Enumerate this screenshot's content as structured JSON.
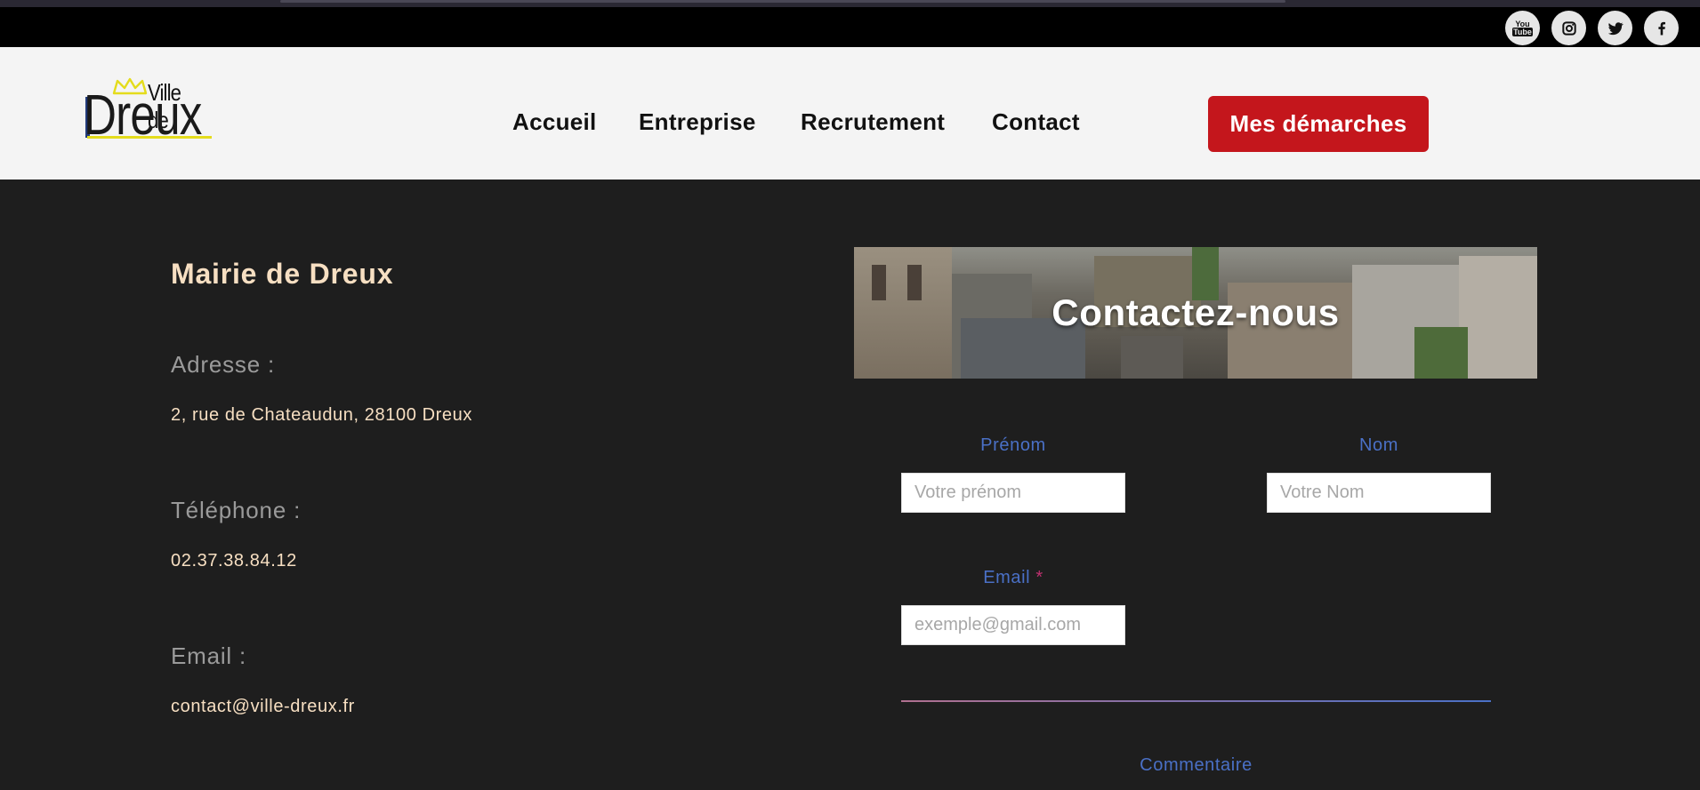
{
  "social": {
    "items": [
      {
        "name": "youtube",
        "icon": "youtube-icon"
      },
      {
        "name": "instagram",
        "icon": "instagram-icon"
      },
      {
        "name": "twitter",
        "icon": "twitter-icon"
      },
      {
        "name": "facebook",
        "icon": "facebook-icon"
      }
    ],
    "youtube_text": "You\nTube"
  },
  "logo": {
    "line1": "Ville de",
    "line2": "Dreux",
    "accent_color": "#e4dc1c",
    "bar_color": "#223b7a"
  },
  "nav": {
    "items": [
      "Accueil",
      "Entreprise",
      "Recrutement",
      "Contact"
    ]
  },
  "cta": {
    "label": "Mes démarches",
    "color": "#c4161c"
  },
  "info": {
    "title": "Mairie de Dreux",
    "address_label": "Adresse :",
    "address_value": "2, rue de Chateaudun, 28100 Dreux",
    "phone_label": "Téléphone :",
    "phone_value": "02.37.38.84.12",
    "email_label": "Email :",
    "email_value": "contact@ville-dreux.fr"
  },
  "contact_form": {
    "banner_title": "Contactez-nous",
    "first_name_label": "Prénom",
    "first_name_placeholder": "Votre prénom",
    "last_name_label": "Nom",
    "last_name_placeholder": "Votre Nom",
    "email_label": "Email",
    "email_required_mark": "*",
    "email_placeholder": "exemple@gmail.com",
    "comment_label": "Commentaire"
  },
  "colors": {
    "background": "#1e1e1e",
    "header_bg": "#f4f4f4",
    "info_text": "#f7dfc2",
    "label_blue": "#4a70c6"
  }
}
